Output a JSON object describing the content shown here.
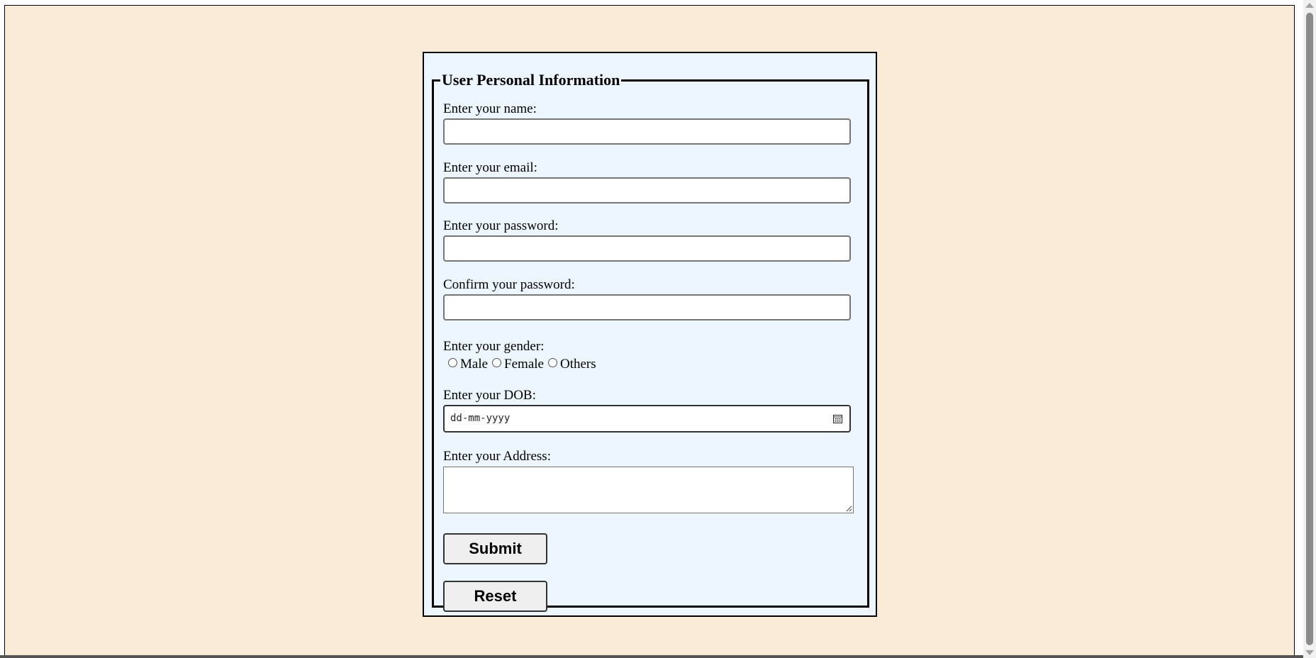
{
  "form": {
    "legend": "User Personal Information",
    "name_label": "Enter your name:",
    "email_label": "Enter your email:",
    "password_label": "Enter your password:",
    "confirm_label": "Confirm your password:",
    "gender_label": "Enter your gender:",
    "gender_options": [
      "Male",
      "Female",
      "Others"
    ],
    "dob_label": "Enter your DOB:",
    "dob_placeholder": "dd-mm-yyyy",
    "address_label": "Enter your Address:",
    "submit_label": "Submit",
    "reset_label": "Reset"
  },
  "colors": {
    "page_background": "#faebd7",
    "form_background": "#edf6fe"
  }
}
